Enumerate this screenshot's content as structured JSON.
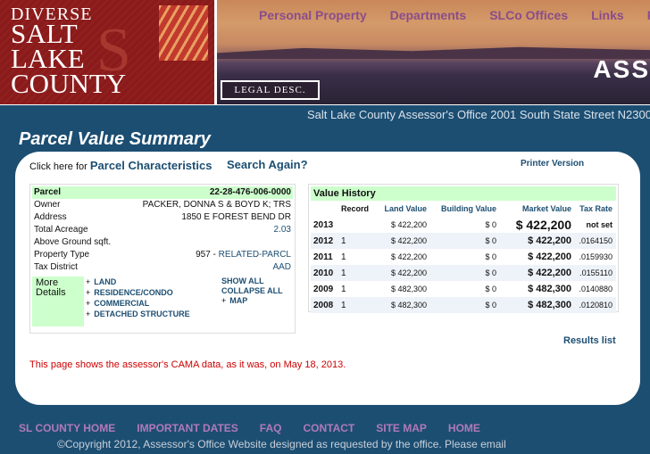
{
  "logo": {
    "line1": "DIVERSE",
    "line2": "SALT",
    "line3": "LAKE",
    "line4": "COUNTY",
    "mark": "S"
  },
  "nav": [
    "Personal Property",
    "Departments",
    "SLCo Offices",
    "Links",
    "Fo"
  ],
  "banner_title": "ASS",
  "legal_desc": "LEGAL DESC.",
  "address_bar": "Salt Lake County Assessor's Office 2001 South State Street N2300",
  "page_title": "Parcel Value Summary",
  "toolbar": {
    "click_prefix": "Click here for ",
    "parcel_characteristics": "Parcel Characteristics",
    "search_again": "Search Again?",
    "printer_version": "Printer Version"
  },
  "parcel": {
    "header_label": "Parcel",
    "header_value": "22-28-476-006-0000",
    "rows": [
      {
        "label": "Owner",
        "value": "PACKER, DONNA S & BOYD K; TRS"
      },
      {
        "label": "Address",
        "value": "1850 E FOREST BEND DR"
      },
      {
        "label": "Total Acreage",
        "value": "2.03"
      },
      {
        "label": "Above Ground sqft.",
        "value": ""
      },
      {
        "label": "Property Type",
        "value_prefix": "957 - ",
        "value": "RELATED-PARCL"
      },
      {
        "label": "Tax District",
        "value": "AAD"
      }
    ]
  },
  "details": {
    "label": "More Details",
    "links": [
      "LAND",
      "RESIDENCE/CONDO",
      "COMMERCIAL",
      "DETACHED STRUCTURE"
    ],
    "show_all": "SHOW ALL",
    "collapse_all": "COLLAPSE ALL",
    "map": "MAP"
  },
  "value_history": {
    "title": "Value History",
    "columns": [
      "",
      "Record",
      "Land Value",
      "Building Value",
      "Market Value",
      "Tax Rate"
    ],
    "rows": [
      {
        "year": "2013",
        "record": "",
        "land": "$ 422,200",
        "building": "$ 0",
        "market": "$ 422,200",
        "tax_rate": "not set"
      },
      {
        "year": "2012",
        "record": "1",
        "land": "$ 422,200",
        "building": "$ 0",
        "market": "$ 422,200",
        "tax_rate": ".0164150"
      },
      {
        "year": "2011",
        "record": "1",
        "land": "$ 422,200",
        "building": "$ 0",
        "market": "$ 422,200",
        "tax_rate": ".0159930"
      },
      {
        "year": "2010",
        "record": "1",
        "land": "$ 422,200",
        "building": "$ 0",
        "market": "$ 422,200",
        "tax_rate": ".0155110"
      },
      {
        "year": "2009",
        "record": "1",
        "land": "$ 482,300",
        "building": "$ 0",
        "market": "$ 482,300",
        "tax_rate": ".0140880"
      },
      {
        "year": "2008",
        "record": "1",
        "land": "$ 482,300",
        "building": "$ 0",
        "market": "$ 482,300",
        "tax_rate": ".0120810"
      }
    ]
  },
  "results_list": "Results list",
  "cama_note": "This page shows the assessor's CAMA data, as it was, on May 18, 2013.",
  "footer_nav": [
    "SL COUNTY HOME",
    "IMPORTANT DATES",
    "FAQ",
    "CONTACT",
    "SITE MAP",
    "HOME"
  ],
  "copyright": "©Copyright 2012, Assessor's Office Website designed as requested by the office. Please email",
  "colors": {
    "brand_blue": "#1c4e72",
    "accent_green": "#ccffcc",
    "nav_purple": "#8a4d8a",
    "note_red": "#cc0000"
  }
}
